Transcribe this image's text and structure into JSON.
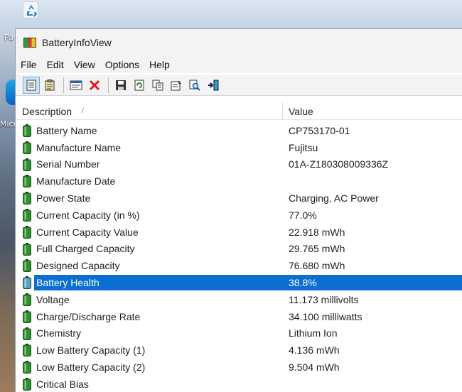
{
  "desktop": {
    "label_1": "Pa",
    "label_2": "Micr"
  },
  "window": {
    "title": "BatteryInfoView"
  },
  "menu": [
    "File",
    "Edit",
    "View",
    "Options",
    "Help"
  ],
  "toolbar": {
    "icons": [
      "details-view-icon",
      "report-icon",
      "window-icon",
      "close-icon",
      "save-icon",
      "refresh-icon",
      "copy-icon",
      "properties-icon",
      "search-icon",
      "exit-icon"
    ]
  },
  "list": {
    "header": {
      "description": "Description",
      "value": "Value"
    },
    "rows": [
      {
        "description": "Battery Name",
        "value": "CP753170-01"
      },
      {
        "description": "Manufacture Name",
        "value": "Fujitsu"
      },
      {
        "description": "Serial Number",
        "value": "01A-Z180308009336Z"
      },
      {
        "description": "Manufacture Date",
        "value": ""
      },
      {
        "description": "Power State",
        "value": "Charging, AC Power"
      },
      {
        "description": "Current Capacity (in %)",
        "value": "77.0%"
      },
      {
        "description": "Current Capacity Value",
        "value": "22.918 mWh"
      },
      {
        "description": "Full Charged Capacity",
        "value": "29.765 mWh"
      },
      {
        "description": "Designed Capacity",
        "value": "76.680 mWh"
      },
      {
        "description": "Battery Health",
        "value": "38.8%"
      },
      {
        "description": "Voltage",
        "value": "11.173 millivolts"
      },
      {
        "description": "Charge/Discharge Rate",
        "value": "34.100 milliwatts"
      },
      {
        "description": "Chemistry",
        "value": "Lithium Ion"
      },
      {
        "description": "Low Battery Capacity (1)",
        "value": "4.136 mWh"
      },
      {
        "description": "Low Battery Capacity (2)",
        "value": "9.504 mWh"
      },
      {
        "description": "Critical Bias",
        "value": ""
      }
    ],
    "selected_index": 9
  },
  "colors": {
    "selection": "#0a6fd0",
    "battery_green": "#2f8f2f"
  }
}
